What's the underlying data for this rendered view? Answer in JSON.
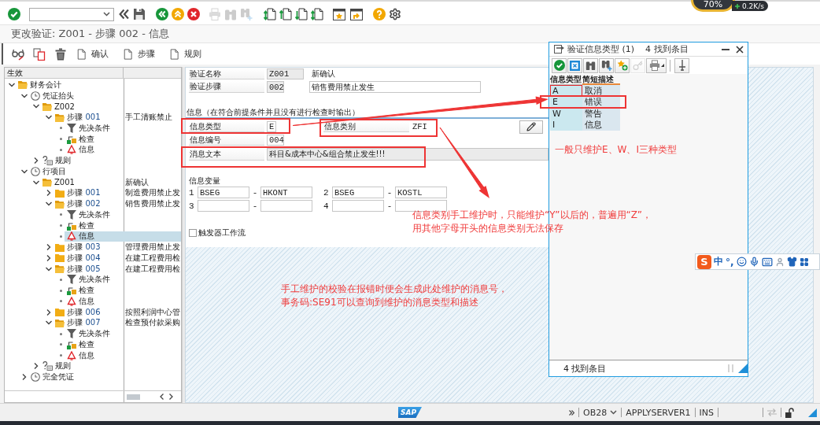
{
  "net_widget": {
    "percent": "70%",
    "speed": "0.2K/s"
  },
  "system_toolbar": [
    {
      "kind": "enter",
      "disabled": false
    },
    {
      "kind": "command-field",
      "disabled": false
    },
    {
      "kind": "collapse",
      "disabled": false
    },
    {
      "kind": "save",
      "disabled": false
    },
    {
      "kind": "back",
      "disabled": false
    },
    {
      "kind": "exit",
      "disabled": false
    },
    {
      "kind": "cancel",
      "disabled": false
    },
    {
      "kind": "print",
      "disabled": true
    },
    {
      "kind": "find",
      "disabled": true
    },
    {
      "kind": "find-next",
      "disabled": true
    },
    {
      "kind": "first-page",
      "disabled": false
    },
    {
      "kind": "previous-page",
      "disabled": false
    },
    {
      "kind": "next-page",
      "disabled": false
    },
    {
      "kind": "last-page",
      "disabled": false
    },
    {
      "kind": "new-session",
      "disabled": false
    },
    {
      "kind": "shortcut",
      "disabled": false
    },
    {
      "kind": "help",
      "disabled": false
    },
    {
      "kind": "settings",
      "disabled": false
    }
  ],
  "title": "更改验证: Z001 - 步骤 002 - 信息",
  "app_toolbar": [
    {
      "kind": "display-change"
    },
    {
      "kind": "copy"
    },
    {
      "kind": "delete"
    },
    {
      "kind": "create",
      "label": "确认"
    },
    {
      "kind": "create",
      "label": "步骤"
    },
    {
      "kind": "create",
      "label": "规则"
    }
  ],
  "tree": {
    "header": "生效",
    "nodes": [
      {
        "kind": "folder",
        "label": "财务会计",
        "expanded": true,
        "selected": false,
        "children": [
          {
            "kind": "event",
            "label": "凭证抬头",
            "expanded": true,
            "selected": false,
            "children": [
              {
                "kind": "folder",
                "label": "Z002",
                "expanded": true,
                "selected": false,
                "children": [
                  {
                    "kind": "folder",
                    "label": "步骤",
                    "code": "001",
                    "description": "手工清账禁止",
                    "expanded": true,
                    "selected": false,
                    "children": [
                      {
                        "kind": "condition",
                        "label": "先决条件",
                        "selected": false
                      },
                      {
                        "kind": "check",
                        "label": "检查",
                        "selected": false
                      },
                      {
                        "kind": "message",
                        "label": "信息",
                        "selected": false
                      }
                    ]
                  }
                ]
              },
              {
                "kind": "rules",
                "label": "规则",
                "expanded": false,
                "selected": false
              }
            ]
          },
          {
            "kind": "event",
            "label": "行项目",
            "expanded": true,
            "selected": false,
            "children": [
              {
                "kind": "folder",
                "label": "Z001",
                "description": "新确认",
                "expanded": true,
                "selected": false,
                "children": [
                  {
                    "kind": "folder",
                    "label": "步骤",
                    "code": "001",
                    "description": "制造费用禁止发",
                    "expanded": false,
                    "selected": false
                  },
                  {
                    "kind": "folder",
                    "label": "步骤",
                    "code": "002",
                    "description": "销售费用禁止发",
                    "expanded": true,
                    "selected": false,
                    "children": [
                      {
                        "kind": "condition",
                        "label": "先决条件",
                        "selected": false
                      },
                      {
                        "kind": "check",
                        "label": "检查",
                        "selected": false
                      },
                      {
                        "kind": "message",
                        "label": "信息",
                        "selected": true
                      }
                    ]
                  },
                  {
                    "kind": "folder",
                    "label": "步骤",
                    "code": "003",
                    "description": "管理费用禁止发",
                    "expanded": false,
                    "selected": false
                  },
                  {
                    "kind": "folder",
                    "label": "步骤",
                    "code": "004",
                    "description": "在建工程费用检",
                    "expanded": false,
                    "selected": false
                  },
                  {
                    "kind": "folder",
                    "label": "步骤",
                    "code": "005",
                    "description": "在建工程费用检",
                    "expanded": true,
                    "selected": false,
                    "children": [
                      {
                        "kind": "condition",
                        "label": "先决条件",
                        "selected": false
                      },
                      {
                        "kind": "check",
                        "label": "检查",
                        "selected": false
                      },
                      {
                        "kind": "message",
                        "label": "信息",
                        "selected": false
                      }
                    ]
                  },
                  {
                    "kind": "folder",
                    "label": "步骤",
                    "code": "006",
                    "description": "按照利润中心管",
                    "expanded": false,
                    "selected": false
                  },
                  {
                    "kind": "folder",
                    "label": "步骤",
                    "code": "007",
                    "description": "检查预付款采购",
                    "expanded": true,
                    "selected": false,
                    "children": [
                      {
                        "kind": "condition",
                        "label": "先决条件",
                        "selected": false
                      },
                      {
                        "kind": "check",
                        "label": "检查",
                        "selected": false
                      },
                      {
                        "kind": "message",
                        "label": "信息",
                        "selected": false
                      }
                    ]
                  }
                ]
              },
              {
                "kind": "rules",
                "label": "规则",
                "expanded": false,
                "selected": false
              }
            ]
          },
          {
            "kind": "event",
            "label": "完全凭证",
            "expanded": false,
            "selected": false
          }
        ]
      }
    ]
  },
  "form": {
    "name": {
      "label": "验证名称",
      "value": "Z001",
      "text": "新确认"
    },
    "step": {
      "label": "验证步骤",
      "value": "002",
      "description": "销售费用禁止发生"
    },
    "group_title": "信息（在符合前提条件并且没有进行检查时输出）",
    "message_type": {
      "label": "信息类型",
      "value": "E"
    },
    "message_class": {
      "label": "信息类别",
      "value": "ZFI"
    },
    "message_number": {
      "label": "信息编号",
      "value": "004"
    },
    "message_text": {
      "label": "消息文本",
      "value": "科目&成本中心&组合禁止发生!!!"
    },
    "variables_title": "信息变量",
    "variables": [
      {
        "index": "1",
        "table": "BSEG",
        "separator": "-",
        "field": "HKONT"
      },
      {
        "index": "2",
        "table": "BSEG",
        "separator": "-",
        "field": "KOSTL"
      },
      {
        "index": "3",
        "separator": "-"
      },
      {
        "index": "4",
        "separator": "-"
      }
    ],
    "workflow": {
      "label": "触发器工作流",
      "checked": false
    }
  },
  "popup": {
    "title": "验证信息类型 (1)",
    "hits": "4 找到条目",
    "toolbar": [
      {
        "kind": "ok",
        "disabled": false
      },
      {
        "kind": "cancel",
        "disabled": false
      },
      {
        "kind": "find",
        "disabled": false
      },
      {
        "kind": "find-next",
        "disabled": false
      },
      {
        "kind": "favorite-add",
        "disabled": false
      },
      {
        "kind": "key",
        "disabled": true
      },
      {
        "kind": "print",
        "disabled": false
      },
      {
        "kind": "pin",
        "disabled": false
      }
    ],
    "columns": [
      "信息类型",
      "简短描述"
    ],
    "rows": [
      {
        "type": "A",
        "text": "取消",
        "focused": true
      },
      {
        "type": "E",
        "text": "错误",
        "focused": false
      },
      {
        "type": "W",
        "text": "警告",
        "focused": false
      },
      {
        "type": "I",
        "text": "信息",
        "focused": false
      }
    ],
    "status": "4 找到条目"
  },
  "annotations": [
    {
      "lines": [
        "一般只维护E、W、I三种类型"
      ]
    },
    {
      "lines": [
        "信息类别手工维护时，只能维护“Y”以后的，普遍用“Z”，",
        "用其他字母开头的信息类别无法保存"
      ]
    },
    {
      "lines": [
        "手工维护的校验在报错时便会生成此处维护的消息号，",
        "事务码:SE91可以查询到维护的消息类型和描述"
      ]
    }
  ],
  "ime_bar": {
    "logo": "S",
    "mode": "中",
    "punctuation": "°,"
  },
  "status_bar": {
    "logo": "SAP",
    "transaction": "OB28",
    "server": "APPLYSERVER1",
    "mode": "INS"
  }
}
